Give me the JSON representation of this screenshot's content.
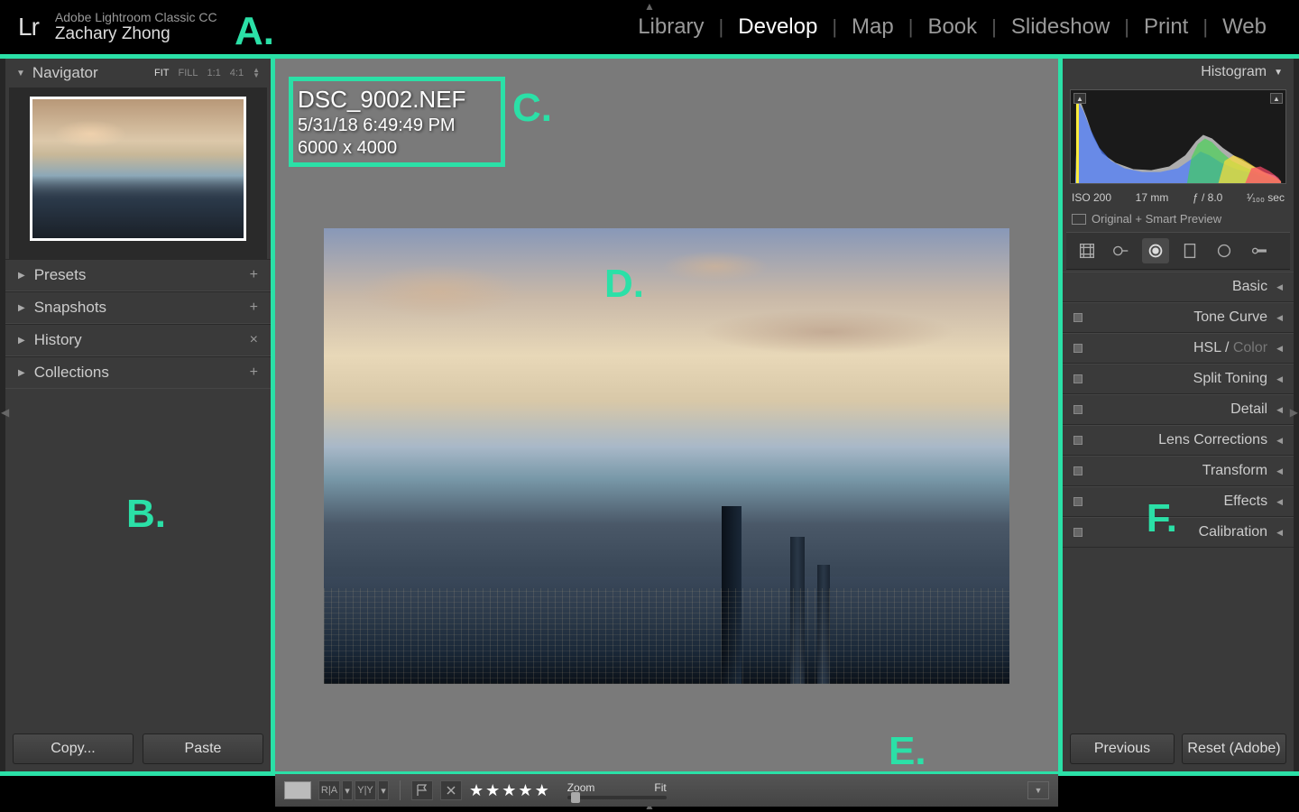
{
  "app": {
    "logo": "Lr",
    "name": "Adobe Lightroom Classic CC",
    "user": "Zachary Zhong"
  },
  "modules": [
    "Library",
    "Develop",
    "Map",
    "Book",
    "Slideshow",
    "Print",
    "Web"
  ],
  "active_module": "Develop",
  "navigator": {
    "title": "Navigator",
    "zoom_modes": [
      "FIT",
      "FILL",
      "1:1",
      "4:1"
    ],
    "active_zoom": "FIT"
  },
  "left_sections": [
    {
      "label": "Presets",
      "action": "+"
    },
    {
      "label": "Snapshots",
      "action": "+"
    },
    {
      "label": "History",
      "action": "×"
    },
    {
      "label": "Collections",
      "action": "+"
    }
  ],
  "left_buttons": {
    "copy": "Copy...",
    "paste": "Paste"
  },
  "image_info": {
    "filename": "DSC_9002.NEF",
    "datetime": "5/31/18 6:49:49 PM",
    "dimensions": "6000 x 4000"
  },
  "histogram": {
    "title": "Histogram",
    "iso": "ISO 200",
    "focal": "17 mm",
    "aperture": "ƒ / 8.0",
    "shutter": "¹⁄₁₀₀ sec",
    "preview_mode": "Original + Smart Preview"
  },
  "right_sections": [
    {
      "label": "Basic",
      "switch": false
    },
    {
      "label": "Tone Curve",
      "switch": true
    },
    {
      "label": "HSL",
      "label2": "Color",
      "switch": true
    },
    {
      "label": "Split Toning",
      "switch": true
    },
    {
      "label": "Detail",
      "switch": true
    },
    {
      "label": "Lens Corrections",
      "switch": true
    },
    {
      "label": "Transform",
      "switch": true
    },
    {
      "label": "Effects",
      "switch": true
    },
    {
      "label": "Calibration",
      "switch": true
    }
  ],
  "right_buttons": {
    "previous": "Previous",
    "reset": "Reset (Adobe)"
  },
  "toolbar": {
    "before_after_1": "R|A",
    "before_after_2": "Y|Y",
    "zoom_label": "Zoom",
    "fit_label": "Fit",
    "rating": 5
  },
  "annotations": {
    "A": "A.",
    "B": "B.",
    "C": "C.",
    "D": "D.",
    "E": "E.",
    "F": "F."
  }
}
